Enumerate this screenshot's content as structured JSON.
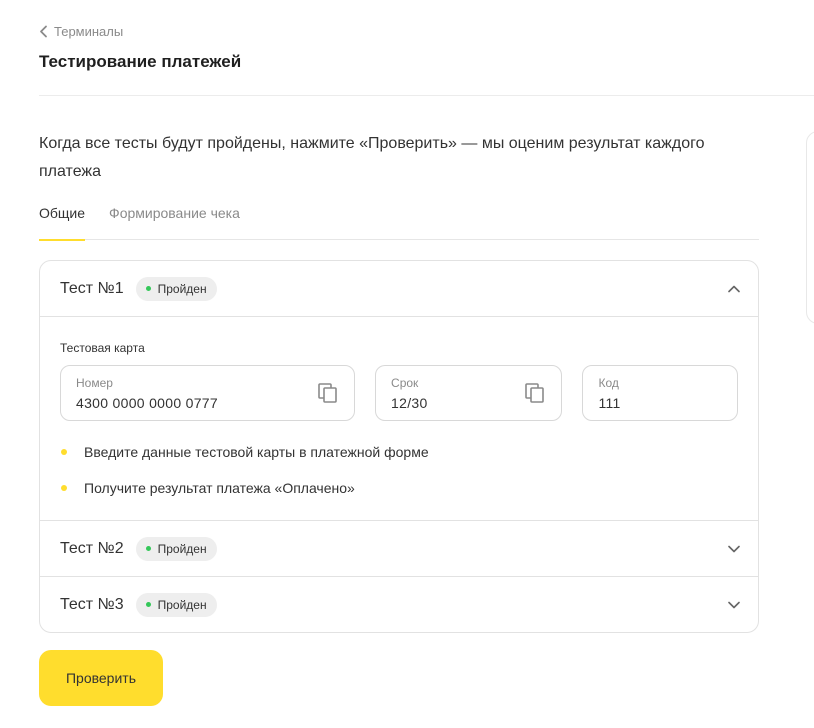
{
  "breadcrumb": {
    "label": "Терминалы"
  },
  "page": {
    "title": "Тестирование платежей",
    "intro": "Когда все тесты будут пройдены, нажмите «Проверить» — мы оценим результат каждого платежа"
  },
  "tabs": [
    {
      "label": "Общие",
      "active": true
    },
    {
      "label": "Формирование чека",
      "active": false
    }
  ],
  "tests": [
    {
      "title": "Тест №1",
      "status": "Пройден",
      "expanded": true,
      "card_label": "Тестовая карта",
      "fields": {
        "number": {
          "label": "Номер",
          "value": "4300 0000 0000 0777",
          "icon": "copy-icon"
        },
        "expiry": {
          "label": "Срок",
          "value": "12/30",
          "icon": "copy-icon"
        },
        "cvc": {
          "label": "Код",
          "value": "111"
        }
      },
      "steps": [
        "Введите данные тестовой карты в платежной форме",
        "Получите результат платежа «Оплачено»"
      ]
    },
    {
      "title": "Тест №2",
      "status": "Пройден",
      "expanded": false
    },
    {
      "title": "Тест №3",
      "status": "Пройден",
      "expanded": false
    }
  ],
  "actions": {
    "check_label": "Проверить"
  },
  "colors": {
    "accent": "#ffdd2d",
    "status_dot": "#34c759",
    "border": "#e2e2e2",
    "muted_text": "#8a8a8a"
  }
}
